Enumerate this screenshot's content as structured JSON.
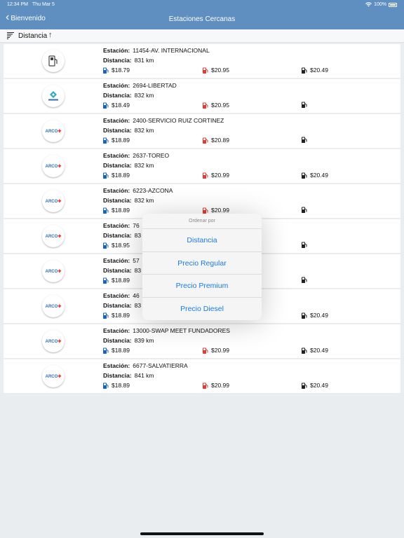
{
  "status": {
    "time": "12:34 PM",
    "date": "Thu Mar 5",
    "battery": "100%",
    "wifi_icon": "wifi-icon"
  },
  "nav": {
    "back_label": "Bienvenido",
    "title": "Estaciones Cercanas"
  },
  "sort": {
    "label": "Distancia",
    "direction": "↑"
  },
  "labels": {
    "station": "Estación:",
    "distance": "Distancia:"
  },
  "colors": {
    "header": "#5f8fc0",
    "regular": "#1565c0",
    "premium": "#e53935",
    "diesel": "#212121",
    "accent": "#1a7be0"
  },
  "stations": [
    {
      "logo": "pump",
      "name": "11454-AV. INTERNACIONAL",
      "distance": "831 km",
      "regular": "$18.79",
      "premium": "$20.95",
      "diesel": "$20.49"
    },
    {
      "logo": "tesoro",
      "name": "2694-LIBERTAD",
      "distance": "832 km",
      "regular": "$18.49",
      "premium": "$20.95",
      "diesel": ""
    },
    {
      "logo": "arco",
      "name": "2400-SERVICIO RUIZ CORTINEZ",
      "distance": "832 km",
      "regular": "$18.89",
      "premium": "$20.89",
      "diesel": ""
    },
    {
      "logo": "arco",
      "name": "2637-TOREO",
      "distance": "832 km",
      "regular": "$18.89",
      "premium": "$20.99",
      "diesel": "$20.49"
    },
    {
      "logo": "arco",
      "name": "6223-AZCONA",
      "distance": "832 km",
      "regular": "$18.89",
      "premium": "$20.99",
      "diesel": ""
    },
    {
      "logo": "arco",
      "name": "76",
      "distance": "83",
      "regular": "$18.95",
      "premium": "",
      "diesel": ""
    },
    {
      "logo": "arco",
      "name": "57",
      "distance": "83",
      "regular": "$18.89",
      "premium": "",
      "diesel": ""
    },
    {
      "logo": "arco",
      "name": "46",
      "distance": "83",
      "regular": "$18.89",
      "premium": "",
      "diesel": "$20.49"
    },
    {
      "logo": "arco",
      "name": "13000-SWAP MEET FUNDADORES",
      "distance": "839 km",
      "regular": "$18.89",
      "premium": "$20.99",
      "diesel": "$20.49"
    },
    {
      "logo": "arco",
      "name": "6677-SALVATIERRA",
      "distance": "841 km",
      "regular": "$18.89",
      "premium": "$20.99",
      "diesel": "$20.49"
    }
  ],
  "sort_menu": {
    "title": "Ordenar por",
    "options": [
      "Distancia",
      "Precio Regular",
      "Precio Premium",
      "Precio Diesel"
    ]
  }
}
